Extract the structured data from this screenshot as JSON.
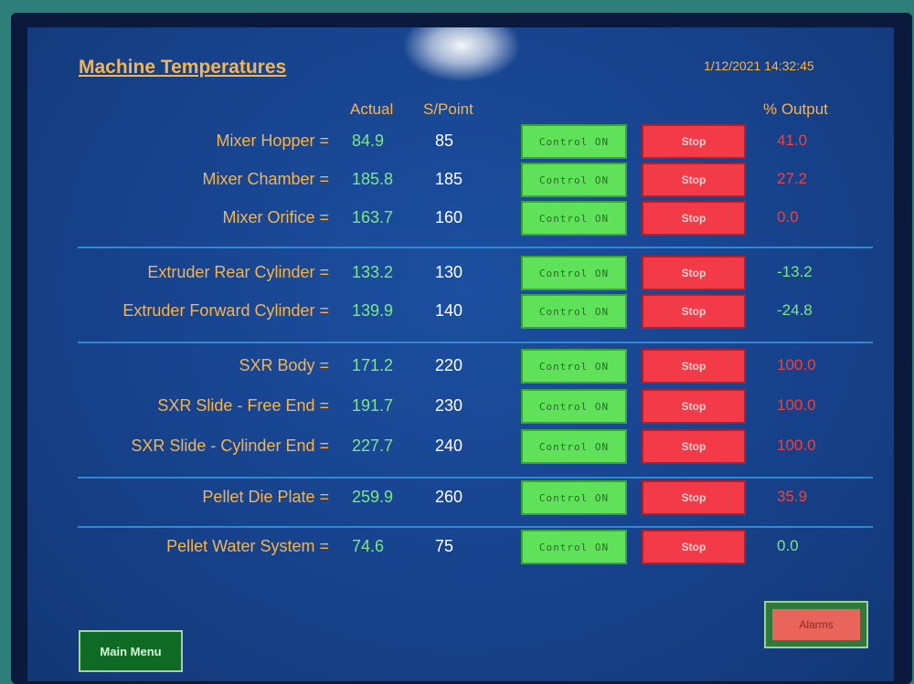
{
  "header": {
    "title": "Machine Temperatures",
    "datetime": "1/12/2021 14:32:45",
    "col_actual": "Actual",
    "col_setpoint": "S/Point",
    "col_output": "% Output"
  },
  "rows": [
    {
      "label": "Mixer Hopper =",
      "actual": "84.9",
      "setpoint": "85",
      "control": "Control ON",
      "stop": "Stop",
      "output": "41.0",
      "output_color": "red"
    },
    {
      "label": "Mixer Chamber =",
      "actual": "185.8",
      "setpoint": "185",
      "control": "Control ON",
      "stop": "Stop",
      "output": "27.2",
      "output_color": "red"
    },
    {
      "label": "Mixer Orifice =",
      "actual": "163.7",
      "setpoint": "160",
      "control": "Control ON",
      "stop": "Stop",
      "output": "0.0",
      "output_color": "red"
    },
    {
      "label": "Extruder Rear Cylinder =",
      "actual": "133.2",
      "setpoint": "130",
      "control": "Control ON",
      "stop": "Stop",
      "output": "-13.2",
      "output_color": "green"
    },
    {
      "label": "Extruder Forward Cylinder =",
      "actual": "139.9",
      "setpoint": "140",
      "control": "Control ON",
      "stop": "Stop",
      "output": "-24.8",
      "output_color": "green"
    },
    {
      "label": "SXR Body =",
      "actual": "171.2",
      "setpoint": "220",
      "control": "Control ON",
      "stop": "Stop",
      "output": "100.0",
      "output_color": "red"
    },
    {
      "label": "SXR Slide - Free End =",
      "actual": "191.7",
      "setpoint": "230",
      "control": "Control ON",
      "stop": "Stop",
      "output": "100.0",
      "output_color": "red"
    },
    {
      "label": "SXR Slide - Cylinder End =",
      "actual": "227.7",
      "setpoint": "240",
      "control": "Control ON",
      "stop": "Stop",
      "output": "100.0",
      "output_color": "red"
    },
    {
      "label": "Pellet Die Plate =",
      "actual": "259.9",
      "setpoint": "260",
      "control": "Control ON",
      "stop": "Stop",
      "output": "35.9",
      "output_color": "red"
    },
    {
      "label": "Pellet Water System =",
      "actual": "74.6",
      "setpoint": "75",
      "control": "Control ON",
      "stop": "Stop",
      "output": "0.0",
      "output_color": "green"
    }
  ],
  "footer": {
    "main_menu": "Main Menu",
    "alarms": "Alarms"
  }
}
